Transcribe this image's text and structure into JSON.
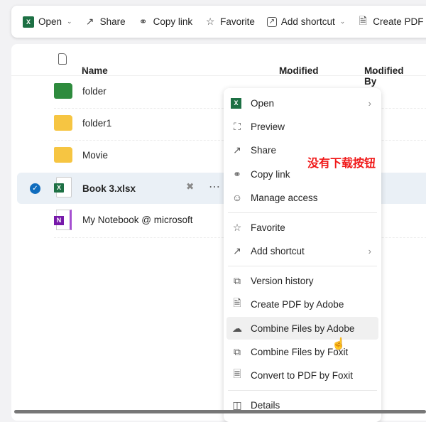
{
  "toolbar": {
    "items": [
      {
        "label": "Open",
        "icon": "excel-icon",
        "dropdown": true
      },
      {
        "label": "Share",
        "icon": "share-icon"
      },
      {
        "label": "Copy link",
        "icon": "link-icon"
      },
      {
        "label": "Favorite",
        "icon": "star-icon"
      },
      {
        "label": "Add shortcut",
        "icon": "shortcut-icon",
        "dropdown": true
      },
      {
        "label": "Create PDF b",
        "icon": "create-pdf-icon"
      }
    ]
  },
  "columns": {
    "name": "Name",
    "sort": "↑",
    "modified": "Modified",
    "modified_by": "Modified By"
  },
  "files": [
    {
      "name": "folder",
      "type": "folder",
      "color": "#2e8b3d"
    },
    {
      "name": "folder1",
      "type": "folder",
      "color": "#f6c542"
    },
    {
      "name": "Movie",
      "type": "folder",
      "color": "#f6c542"
    },
    {
      "name": "Book 3.xlsx",
      "type": "excel",
      "selected": true
    },
    {
      "name": "My Notebook @ microsoft",
      "type": "onenote"
    }
  ],
  "menu": {
    "items": [
      {
        "label": "Open",
        "icon": "excel-icon",
        "submenu": true
      },
      {
        "label": "Preview",
        "icon": "preview-icon"
      },
      {
        "label": "Share",
        "icon": "share-icon"
      },
      {
        "label": "Copy link",
        "icon": "link-icon"
      },
      {
        "label": "Manage access",
        "icon": "person-icon"
      },
      {
        "label": "Favorite",
        "icon": "star-icon"
      },
      {
        "label": "Add shortcut",
        "icon": "shortcut-icon",
        "submenu": true
      },
      {
        "label": "Version history",
        "icon": "history-icon"
      },
      {
        "label": "Create PDF by Adobe",
        "icon": "create-pdf-icon"
      },
      {
        "label": "Combine Files by Adobe",
        "icon": "combine-icon",
        "hovered": true
      },
      {
        "label": "Combine Files by Foxit",
        "icon": "combine-foxit-icon"
      },
      {
        "label": "Convert to PDF by Foxit",
        "icon": "convert-icon"
      },
      {
        "label": "Details",
        "icon": "details-icon"
      }
    ]
  },
  "annotation": "没有下载按钮",
  "colors": {
    "accent": "#0f6cbd",
    "annotation": "#f01818",
    "selected_row": "#eaf0f6"
  }
}
